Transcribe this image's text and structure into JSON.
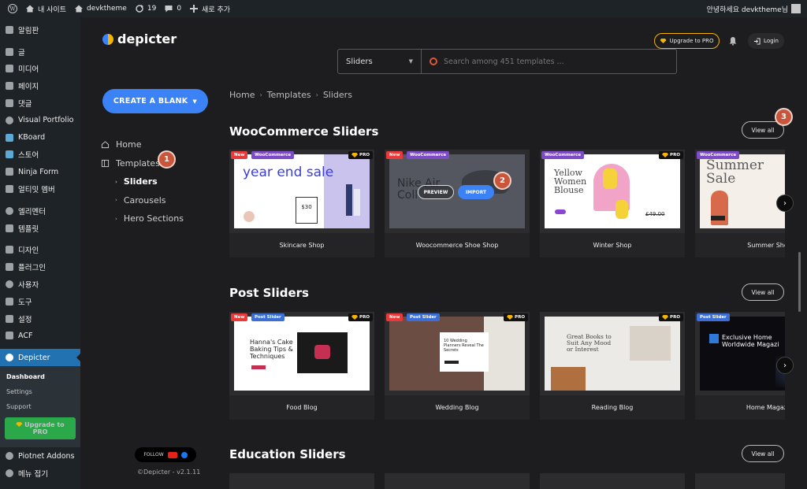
{
  "admin_bar": {
    "site_name": "내 사이트",
    "theme_name": "devktheme",
    "updates_count": "19",
    "comments_count": "0",
    "new_label": "새로 추가",
    "greeting": "안녕하세요 devktheme님"
  },
  "wp_menu": {
    "items": [
      {
        "label": "알림판",
        "icon": "dashboard-icon"
      },
      {
        "label": "글",
        "icon": "pin-icon"
      },
      {
        "label": "미디어",
        "icon": "media-icon"
      },
      {
        "label": "페이지",
        "icon": "page-icon"
      },
      {
        "label": "댓글",
        "icon": "comment-icon"
      },
      {
        "label": "Visual Portfolio",
        "icon": "portfolio-icon"
      },
      {
        "label": "KBoard",
        "icon": "kboard-icon"
      },
      {
        "label": "스토어",
        "icon": "store-icon"
      },
      {
        "label": "Ninja Form",
        "icon": "form-icon"
      },
      {
        "label": "얼티밋 멤버",
        "icon": "member-icon"
      },
      {
        "label": "엘리멘터",
        "icon": "elementor-icon"
      },
      {
        "label": "템플릿",
        "icon": "folder-icon"
      },
      {
        "label": "디자인",
        "icon": "brush-icon"
      },
      {
        "label": "플러그인",
        "icon": "plugin-icon"
      },
      {
        "label": "사용자",
        "icon": "user-icon"
      },
      {
        "label": "도구",
        "icon": "wrench-icon"
      },
      {
        "label": "설정",
        "icon": "settings-icon"
      },
      {
        "label": "ACF",
        "icon": "acf-icon"
      }
    ],
    "active": "Depicter",
    "submenu": [
      "Dashboard",
      "Settings",
      "Support"
    ],
    "upgrade": "Upgrade to PRO",
    "after": [
      {
        "label": "Piotnet Addons",
        "icon": "piotnet-icon"
      },
      {
        "label": "메뉴 접기",
        "icon": "collapse-icon"
      }
    ]
  },
  "app": {
    "brand": "depicter",
    "upgrade_label": "Upgrade to PRO",
    "login_label": "Login",
    "search_select": "Sliders",
    "search_placeholder": "Search among 451 templates ...",
    "create_label": "CREATE A BLANK",
    "nav": {
      "home": "Home",
      "templates": "Templates",
      "sub": [
        "Sliders",
        "Carousels",
        "Hero Sections"
      ]
    },
    "breadcrumb": [
      "Home",
      "Templates",
      "Sliders"
    ],
    "follow_label": "FOLLOW",
    "copyright": "©Depicter - v2.1.11",
    "markers": [
      "1",
      "2",
      "3"
    ],
    "preview_label": "PREVIEW",
    "import_label": "IMPORT",
    "view_all": "View all"
  },
  "sections": [
    {
      "title": "WooCommerce Sliders",
      "cards": [
        {
          "name": "Skincare Shop",
          "new": true,
          "tag": "WooCommerce",
          "pro": true,
          "headline": "year end sale",
          "price": "$30"
        },
        {
          "name": "Woocommerce Shoe Shop",
          "new": true,
          "tag": "WooCommerce",
          "pro": false,
          "headline": "Nike Air Coll"
        },
        {
          "name": "Winter Shop",
          "new": false,
          "tag": "WooCommerce",
          "pro": true,
          "headline": "Yellow Women Blouse",
          "price": "£49.00"
        },
        {
          "name": "Summer Sho",
          "new": false,
          "tag": "WooCommerce",
          "pro": false,
          "headline": "Summer Sale"
        }
      ]
    },
    {
      "title": "Post Sliders",
      "cards": [
        {
          "name": "Food Blog",
          "new": true,
          "tag": "Post Slider",
          "pro": true,
          "headline": "Hanna's Cake Baking Tips & Techniques"
        },
        {
          "name": "Wedding Blog",
          "new": true,
          "tag": "Post Slider",
          "pro": true,
          "headline": "10 Wedding Planners Reveal The Secrets"
        },
        {
          "name": "Reading Blog",
          "new": false,
          "tag": "",
          "pro": true,
          "headline": "Great Books to Suit Any Mood or Interest"
        },
        {
          "name": "Home Magazi",
          "new": false,
          "tag": "Post Slider",
          "pro": false,
          "headline": "Exclusive Home Worldwide Magazi"
        }
      ]
    },
    {
      "title": "Education Sliders",
      "cards": []
    }
  ],
  "pro_label": "PRO",
  "new_label": "New",
  "colors": {
    "accent": "#3b82f6",
    "wp_active": "#2271b1",
    "marker": "#c9553a",
    "gold": "#f5b400"
  }
}
